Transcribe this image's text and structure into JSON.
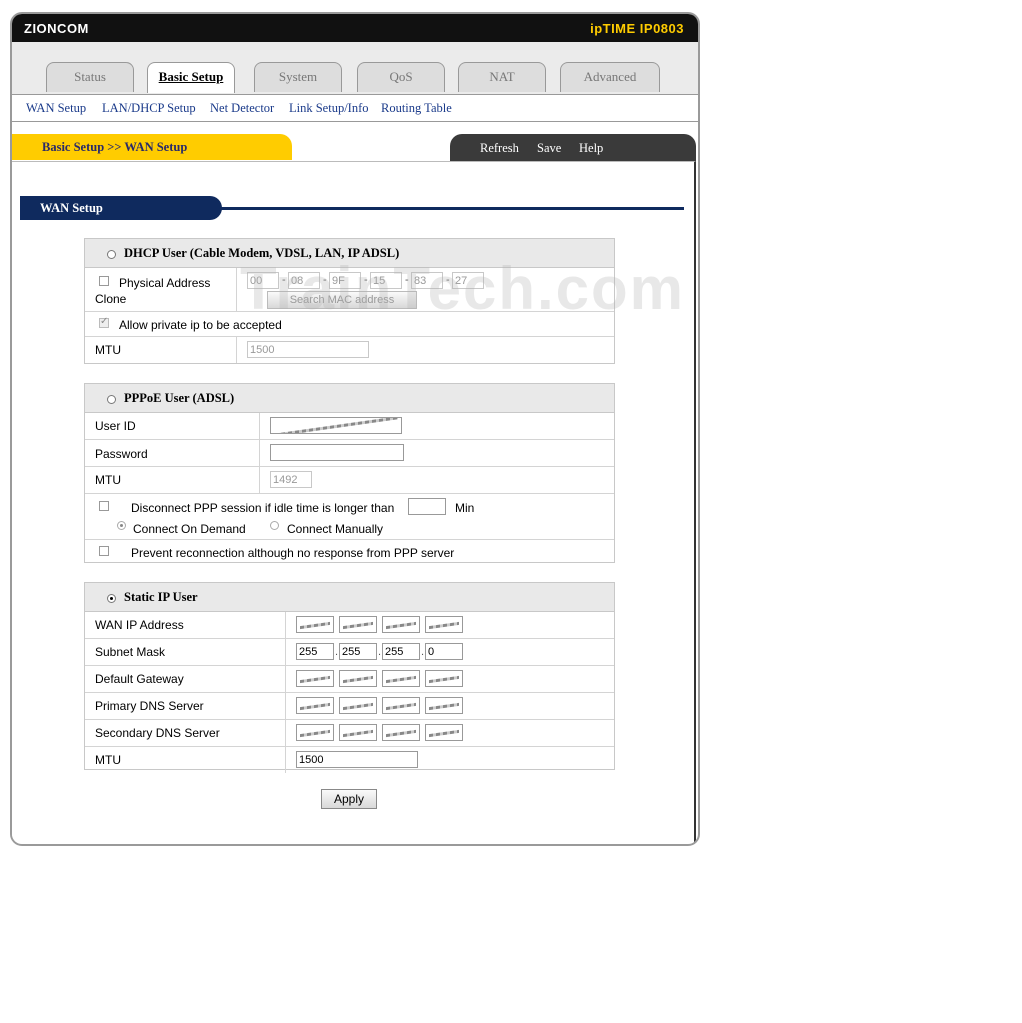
{
  "header": {
    "brand": "ZIONCOM",
    "model": "ipTIME IP0803"
  },
  "tabs": [
    "Status",
    "Basic Setup",
    "System",
    "QoS",
    "NAT",
    "Advanced"
  ],
  "active_tab": "Basic Setup",
  "subnav": [
    "WAN Setup",
    "LAN/DHCP Setup",
    "Net Detector",
    "Link Setup/Info",
    "Routing Table"
  ],
  "breadcrumb": "Basic Setup >> WAN Setup",
  "actions": {
    "refresh": "Refresh",
    "save": "Save",
    "help": "Help"
  },
  "section_title": "WAN Setup",
  "watermark": "TrainTech.com",
  "dhcp": {
    "title": "DHCP User (Cable Modem, VDSL, LAN, IP ADSL)",
    "phys_label": "Physical Address Clone",
    "mac": [
      "00",
      "08",
      "9F",
      "15",
      "83",
      "27"
    ],
    "search_mac": "Search MAC address",
    "allow_private": "Allow private ip to be accepted",
    "mtu_label": "MTU",
    "mtu": "1500"
  },
  "pppoe": {
    "title": "PPPoE User (ADSL)",
    "userid_label": "User ID",
    "password_label": "Password",
    "mtu_label": "MTU",
    "mtu": "1492",
    "disconnect": "Disconnect PPP session if idle time is longer than",
    "min": "Min",
    "connect_on_demand": "Connect On Demand",
    "connect_manually": "Connect Manually",
    "prevent": "Prevent reconnection although no response from PPP server"
  },
  "static": {
    "title": "Static IP User",
    "wan_ip_label": "WAN IP Address",
    "subnet_label": "Subnet Mask",
    "subnet": [
      "255",
      "255",
      "255",
      "0"
    ],
    "gateway_label": "Default Gateway",
    "dns1_label": "Primary DNS Server",
    "dns2_label": "Secondary DNS Server",
    "mtu_label": "MTU",
    "mtu": "1500"
  },
  "apply": "Apply"
}
